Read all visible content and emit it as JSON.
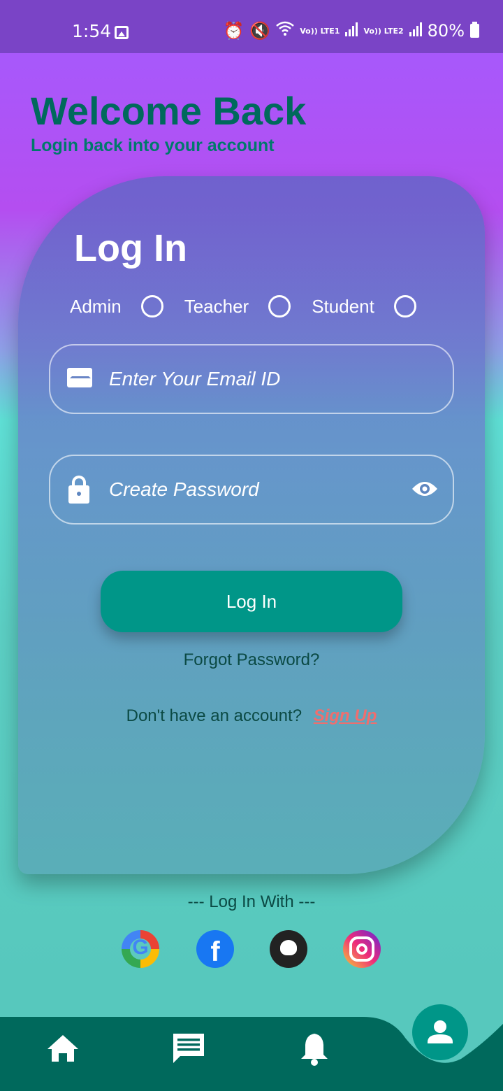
{
  "status_bar": {
    "time": "1:54",
    "battery": "80%",
    "sim1": "Vo)) LTE1",
    "sim2": "Vo)) LTE2"
  },
  "header": {
    "title": "Welcome Back",
    "subtitle": "Login back into your account"
  },
  "card": {
    "title": "Log In",
    "roles": [
      {
        "label": "Admin",
        "selected": false
      },
      {
        "label": "Teacher",
        "selected": false
      },
      {
        "label": "Student",
        "selected": false
      }
    ],
    "email_placeholder": "Enter Your Email ID",
    "password_placeholder": "Create Password",
    "login_button": "Log In",
    "forgot_password": "Forgot Password?",
    "no_account_text": "Don't have an account?",
    "signup_link": "Sign Up"
  },
  "social": {
    "heading": "--- Log In With ---",
    "providers": [
      "google-icon",
      "facebook-icon",
      "github-icon",
      "instagram-icon"
    ]
  },
  "bottom_nav": {
    "items": [
      "home-icon",
      "chat-icon",
      "bell-icon",
      "profile-icon"
    ]
  },
  "colors": {
    "accent": "#009688",
    "nav_bg": "#00695c",
    "status_bar": "#7a44c6",
    "signup_link": "#ef6e6e"
  }
}
